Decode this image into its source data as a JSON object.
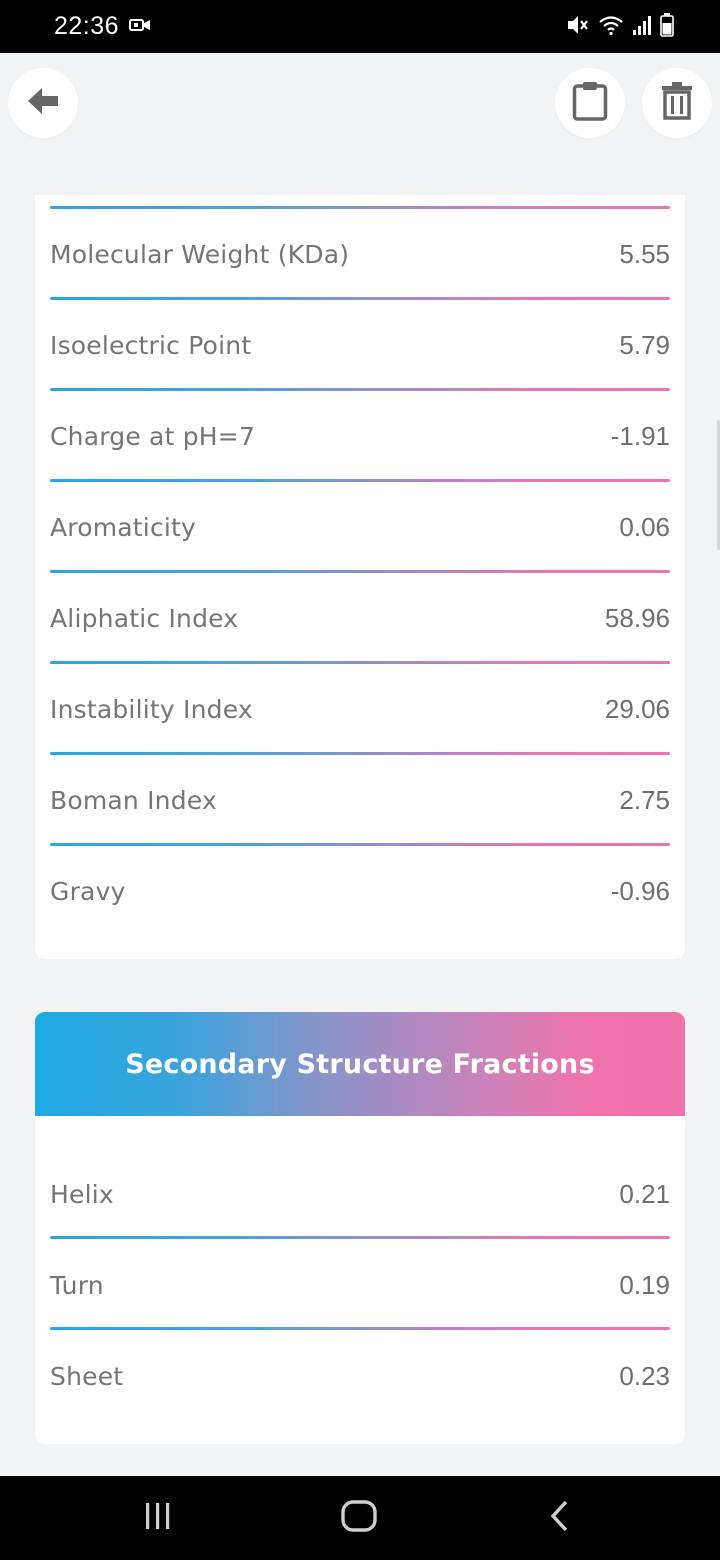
{
  "status_bar": {
    "time": "22:36"
  },
  "icons": {
    "back": "back-arrow-icon",
    "clipboard": "clipboard-icon",
    "trash": "trash-icon",
    "video": "video-camera-icon",
    "mute": "mute-icon",
    "wifi": "wifi-icon",
    "signal": "signal-icon",
    "battery": "battery-icon"
  },
  "properties": [
    {
      "label": "Molecular Weight (KDa)",
      "value": "5.55"
    },
    {
      "label": "Isoelectric Point",
      "value": "5.79"
    },
    {
      "label": "Charge at pH=7",
      "value": "-1.91"
    },
    {
      "label": "Aromaticity",
      "value": "0.06"
    },
    {
      "label": "Aliphatic Index",
      "value": "58.96"
    },
    {
      "label": "Instability Index",
      "value": "29.06"
    },
    {
      "label": "Boman Index",
      "value": "2.75"
    },
    {
      "label": "Gravy",
      "value": "-0.96"
    }
  ],
  "secondary_structure": {
    "title": "Secondary Structure Fractions",
    "items": [
      {
        "label": "Helix",
        "value": "0.21"
      },
      {
        "label": "Turn",
        "value": "0.19"
      },
      {
        "label": "Sheet",
        "value": "0.23"
      }
    ]
  },
  "colors": {
    "gradient_start": "#1eaae5",
    "gradient_mid": "#9b8dc8",
    "gradient_end": "#ef72ad",
    "background": "#f2f3f5"
  }
}
